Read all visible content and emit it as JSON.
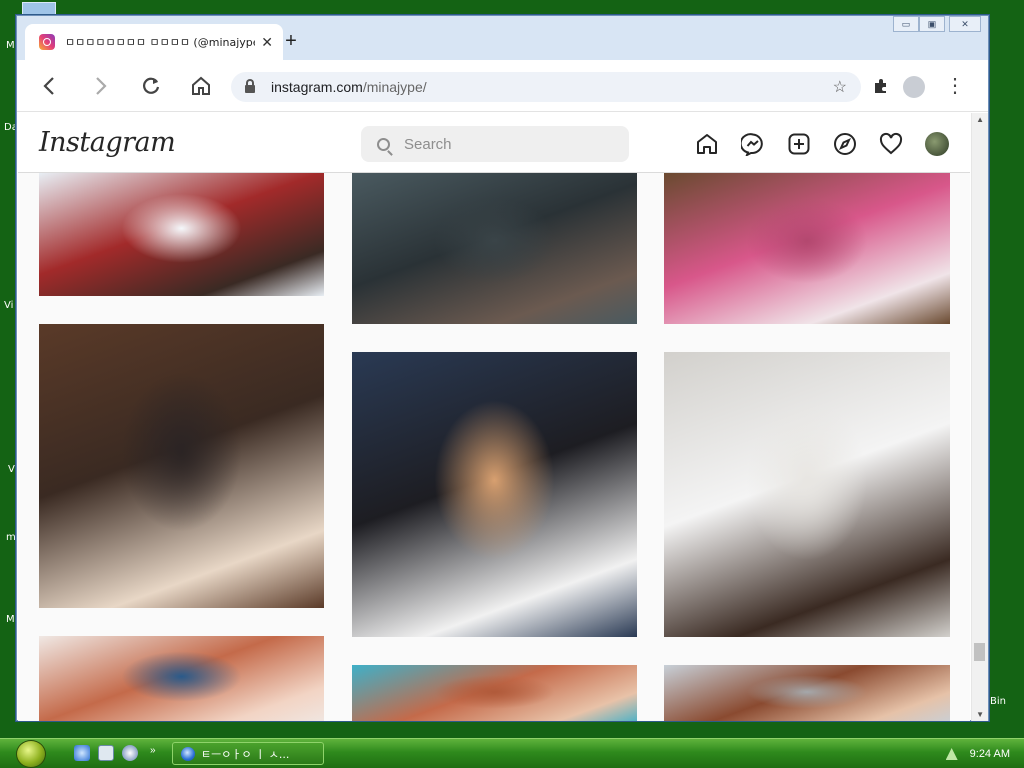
{
  "desktop": {
    "labels": [
      "M",
      "Da",
      "Vi",
      "V",
      "m",
      "M",
      "Bin"
    ]
  },
  "browser": {
    "tab_title": "ㅁㅁㅁㅁㅁㅁㅁㅁ ㅁㅁㅁㅁ (@minajype) •",
    "tab_close": "✕",
    "new_tab": "+",
    "url_host": "instagram.com",
    "url_path": "/minajype/",
    "window_controls": [
      "▭",
      "▣",
      "✕"
    ]
  },
  "instagram": {
    "logo": "Instagram",
    "search_placeholder": "Search",
    "nav_icons": [
      "home-icon",
      "messenger-icon",
      "new-post-icon",
      "explore-icon",
      "activity-heart-icon",
      "profile-avatar"
    ]
  },
  "grid": {
    "tiles": [
      {
        "name": "post-tile",
        "colors": [
          "#e8eef4",
          "#a22a2a",
          "#3a2a24",
          "#f5f8fb"
        ]
      },
      {
        "name": "post-tile",
        "colors": [
          "#4a5a60",
          "#2a3236",
          "#6b5a50",
          "#3a4448"
        ]
      },
      {
        "name": "post-tile",
        "colors": [
          "#6a4a30",
          "#d8578a",
          "#f0e4e8",
          "#b3486f"
        ]
      },
      {
        "name": "post-tile",
        "colors": [
          "#5a3a28",
          "#3a2a22",
          "#e8d7c6",
          "#2b2424"
        ]
      },
      {
        "name": "post-tile",
        "colors": [
          "#2a3a54",
          "#1d1d22",
          "#f1f1f1",
          "#d8a070"
        ]
      },
      {
        "name": "post-tile",
        "colors": [
          "#d2d0cc",
          "#f4f4f4",
          "#3a2a22",
          "#e8e6e2"
        ]
      },
      {
        "name": "post-tile",
        "colors": [
          "#f0e8e4",
          "#c46a4a",
          "#f2d4c4",
          "#2a5a8a"
        ]
      },
      {
        "name": "post-tile",
        "colors": [
          "#3fb0c8",
          "#c46a4a",
          "#e8c2a8",
          "#b05a3a"
        ]
      },
      {
        "name": "post-tile",
        "colors": [
          "#c8d0d8",
          "#8a4a30",
          "#e6c2a8",
          "#a5a8ab"
        ]
      }
    ]
  },
  "taskbar": {
    "task_label": "ㅌㅡㅇㅏㅇ ㅣ ㅅ...",
    "time": "9:24 AM"
  }
}
